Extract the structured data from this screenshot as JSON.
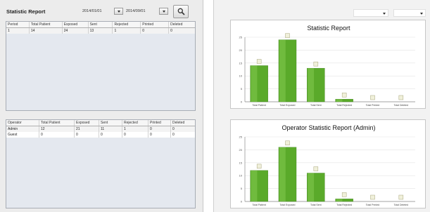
{
  "left": {
    "title": "Statistic Report",
    "date_start": "2014/01/01",
    "date_end": "2014/09/01",
    "top_table": {
      "columns": [
        "Period",
        "Total Patient",
        "Exposed",
        "Sent",
        "Rejected",
        "Printed",
        "Deleted"
      ],
      "rows": [
        [
          "1",
          "14",
          "24",
          "13",
          "1",
          "0",
          "0"
        ]
      ]
    },
    "bottom_table": {
      "columns": [
        "Operator",
        "Total Patient",
        "Exposed",
        "Sent",
        "Rejected",
        "Printed",
        "Deleted"
      ],
      "rows": [
        [
          "Admin",
          "12",
          "21",
          "11",
          "1",
          "0",
          "0"
        ],
        [
          "Guest",
          "0",
          "0",
          "0",
          "0",
          "0",
          "0"
        ]
      ]
    }
  },
  "right": {
    "combo_1": "",
    "combo_2": ""
  },
  "chart_data": [
    {
      "type": "bar",
      "title": "Statistic Report",
      "categories": [
        "Total Patient",
        "Total Exposed",
        "Total Sent",
        "Total Rejected",
        "Total Printed",
        "Total Deleted"
      ],
      "values": [
        14,
        24,
        13,
        1,
        0,
        0
      ],
      "ylim": [
        0,
        25
      ],
      "yticks": [
        0,
        5,
        10,
        15,
        20,
        25
      ],
      "bar_color": "#5aaa2a",
      "grid": true
    },
    {
      "type": "bar",
      "title": "Operator Statistic Report (Admin)",
      "categories": [
        "Total Patient",
        "Total Exposed",
        "Total Sent",
        "Total Rejected",
        "Total Printed",
        "Total Deleted"
      ],
      "values": [
        12,
        21,
        11,
        1,
        0,
        0
      ],
      "ylim": [
        0,
        25
      ],
      "yticks": [
        0,
        5,
        10,
        15,
        20,
        25
      ],
      "bar_color": "#5aaa2a",
      "grid": true
    }
  ]
}
